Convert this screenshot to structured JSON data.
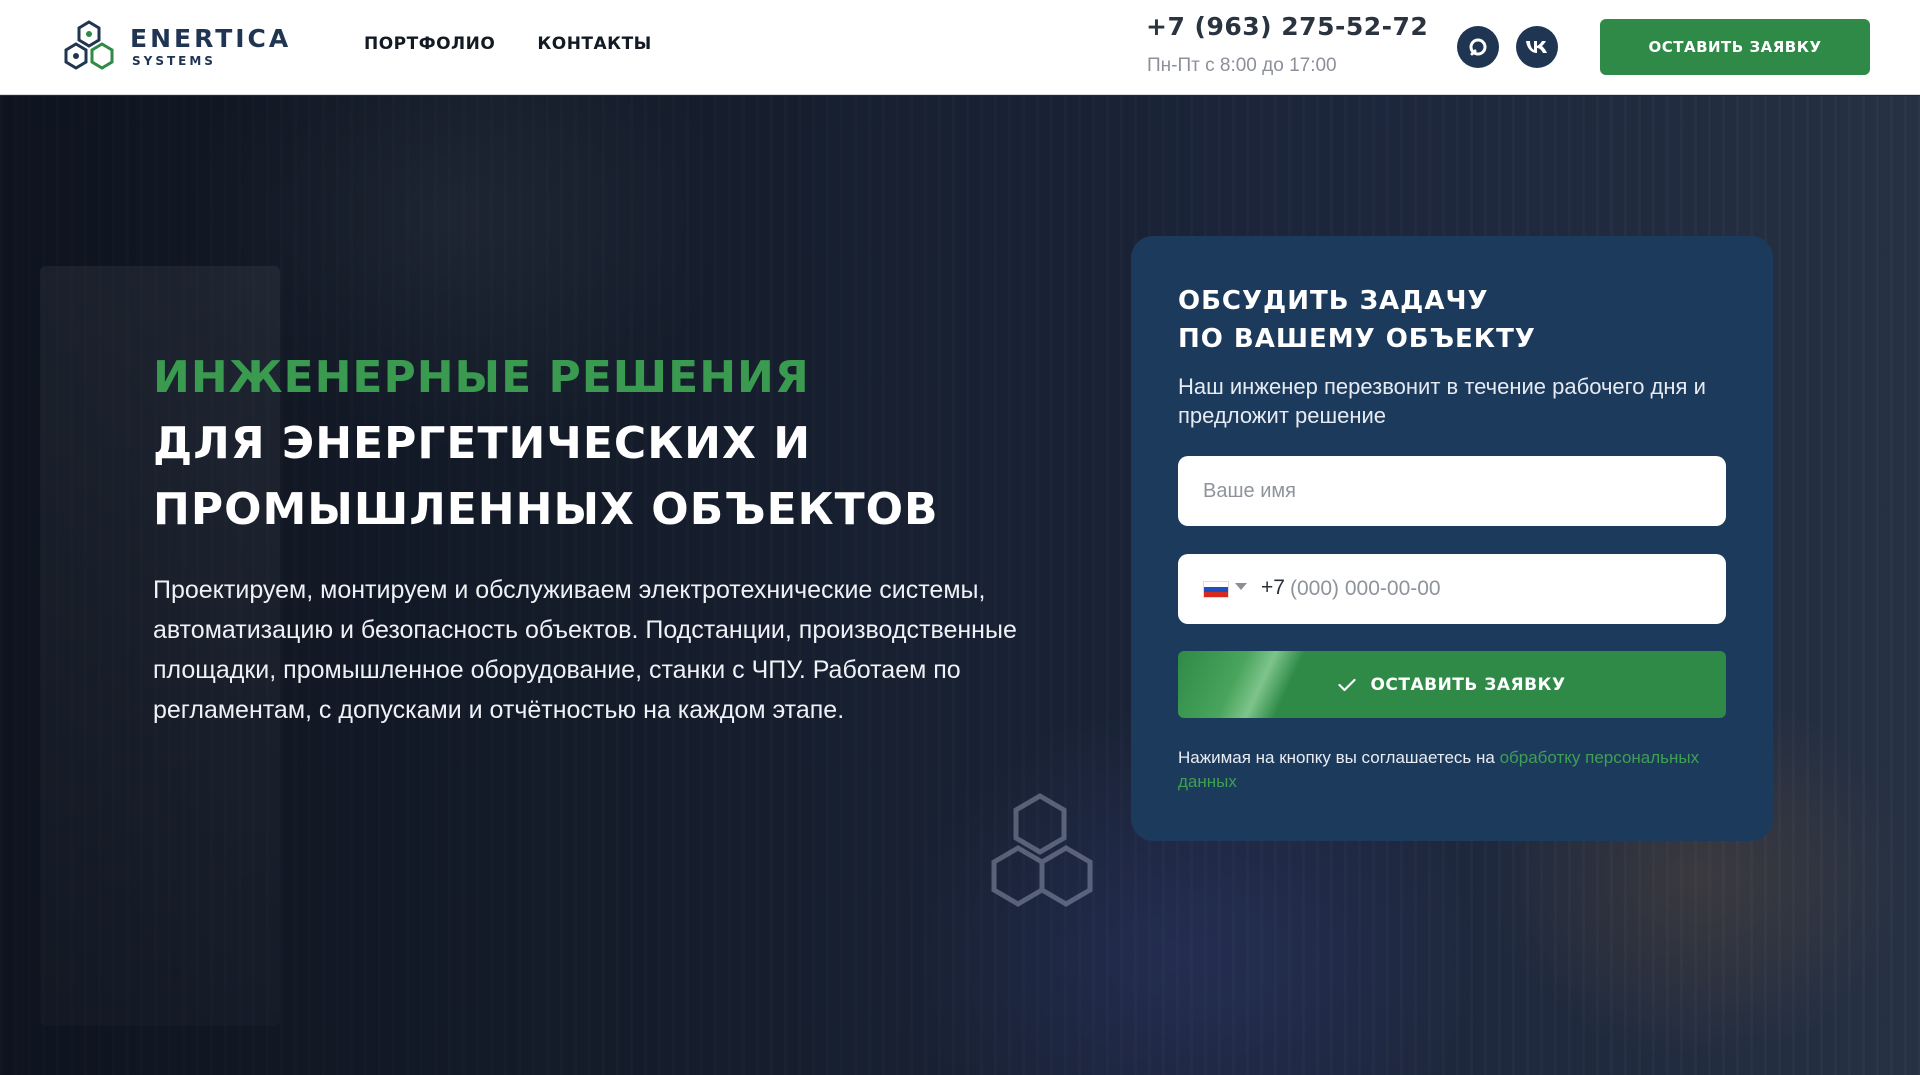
{
  "header": {
    "logo_name": "ENERTICA",
    "logo_sub": "SYSTEMS",
    "nav": [
      {
        "label": "ПОРТФОЛИО"
      },
      {
        "label": "КОНТАКТЫ"
      }
    ],
    "phone": "+7 (963) 275-52-72",
    "hours": "Пн-Пт с 8:00 до 17:00",
    "social": [
      {
        "icon": "max-messenger-icon"
      },
      {
        "icon": "vk-icon"
      }
    ],
    "cta_label": "ОСТАВИТЬ ЗАЯВКУ"
  },
  "hero": {
    "title_green": "ИНЖЕНЕРНЫЕ РЕШЕНИЯ",
    "title_line2": "ДЛЯ ЭНЕРГЕТИЧЕСКИХ И",
    "title_line3": "ПРОМЫШЛЕННЫХ ОБЪЕКТОВ",
    "lead_lines": [
      "Проектируем, монтируем и обслуживаем электротехнические системы,",
      "автоматизацию и безопасность объектов. Подстанции, производственные",
      "площадки, промышленное оборудование, станки с ЧПУ. Работаем по",
      "регламентам, с допусками и отчётностью на каждом этапе."
    ]
  },
  "form": {
    "title_line1": "ОБСУДИТЬ ЗАДАЧУ",
    "title_line2": "ПО ВАШЕМУ ОБЪЕКТУ",
    "subtitle": "Наш инженер перезвонит в течение рабочего дня и предложит решение",
    "name_placeholder": "Ваше имя",
    "phone_prefix": "+7",
    "phone_placeholder": "(000) 000-00-00",
    "submit_label": "ОСТАВИТЬ ЗАЯВКУ",
    "consent_text": "Нажимая на кнопку вы соглашаетесь на ",
    "consent_link": "обработку персональных данных"
  },
  "colors": {
    "brand_green": "#2e8a46",
    "brand_navy": "#1c3a5c"
  }
}
